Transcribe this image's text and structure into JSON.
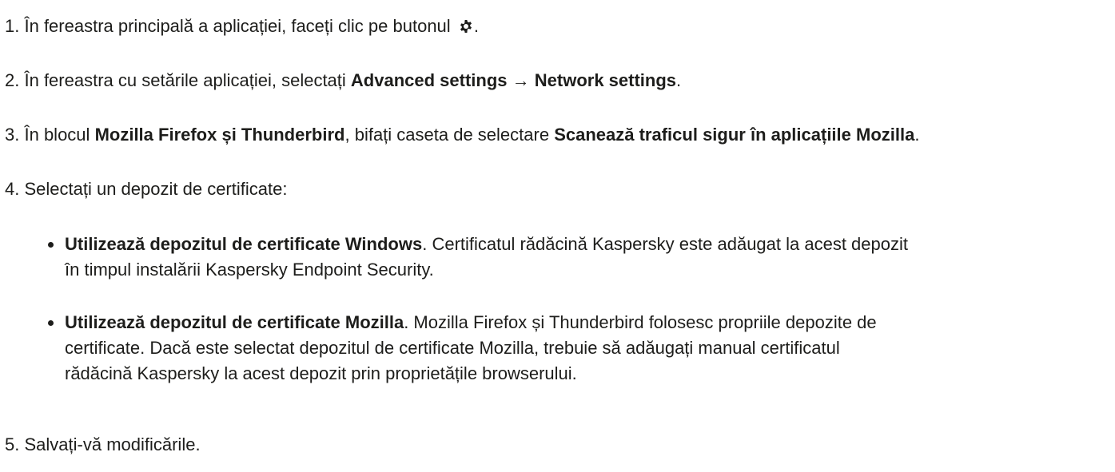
{
  "steps": [
    {
      "number": "1.",
      "text_before": "În fereastra principală a aplicației, faceți clic pe butonul",
      "icon": "gear-icon",
      "text_after": "."
    },
    {
      "number": "2.",
      "text_before": "În fereastra cu setările aplicației, selectați",
      "bold": "Advanced settings → Network settings",
      "text_after": "."
    },
    {
      "number": "3.",
      "text_before": "În blocul",
      "bold1": "Mozilla Firefox și Thunderbird",
      "text_middle": ", bifați caseta de selectare",
      "bold2": "Scanează traficul sigur în aplicațiile Mozilla",
      "text_after": "."
    },
    {
      "number": "4.",
      "text": "Selectați un depozit de certificate:"
    },
    {
      "number": "5.",
      "text": "Salvați-vă modificările."
    }
  ],
  "options": [
    {
      "bold": "Utilizează depozitul de certificate Windows",
      "line1": ". Certificatul rădăcină Kaspersky este adăugat la acest depozit",
      "line2": "în timpul instalării Kaspersky Endpoint Security."
    },
    {
      "bold": "Utilizează depozitul de certificate Mozilla",
      "line1": ". Mozilla Firefox și Thunderbird folosesc propriile depozite de",
      "line2": "certificate. Dacă este selectat depozitul de certificate Mozilla, trebuie să adăugați manual certificatul",
      "line3": "rădăcină Kaspersky la acest depozit prin proprietățile browserului."
    }
  ]
}
